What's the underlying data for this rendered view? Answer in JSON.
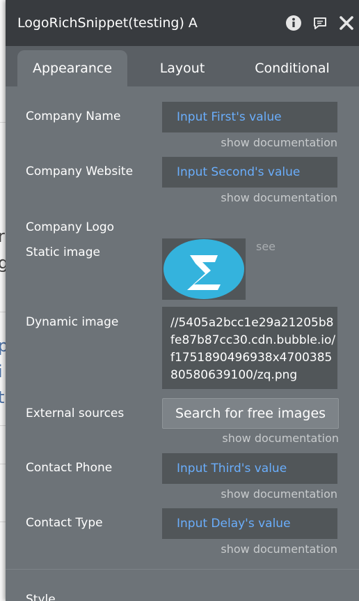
{
  "panel": {
    "title": "LogoRichSnippet(testing) A",
    "icons": [
      "info-icon",
      "comment-icon",
      "close-icon"
    ]
  },
  "tabs": [
    {
      "label": "Appearance",
      "active": true
    },
    {
      "label": "Layout",
      "active": false
    },
    {
      "label": "Conditional",
      "active": false
    }
  ],
  "fields": {
    "company_name": {
      "label": "Company Name",
      "value": "Input First's value",
      "doc": "show documentation"
    },
    "company_website": {
      "label": "Company Website",
      "value": "Input Second's value",
      "doc": "show documentation"
    },
    "company_logo": {
      "label": "Company Logo"
    },
    "static_image": {
      "label": "Static image",
      "see": "see"
    },
    "dynamic_image": {
      "label": "Dynamic image",
      "value": "//5405a2bcc1e29a21205b8fe87b87cc30.cdn.bubble.io/f1751890496938x470038580580639100/zq.png"
    },
    "external_sources": {
      "label": "External sources",
      "button": "Search for free images",
      "doc": "show documentation"
    },
    "contact_phone": {
      "label": "Contact Phone",
      "value": "Input Third's value",
      "doc": "show documentation"
    },
    "contact_type": {
      "label": "Contact Type",
      "value": "Input Delay's value",
      "doc": "show documentation"
    },
    "style": {
      "label": "Style"
    }
  },
  "colors": {
    "panel_bg": "#6d7378",
    "titlebar_bg": "#383b3f",
    "input_bg": "#515659",
    "dynamic_value": "#6aaefc",
    "logo_bg": "#34b3dd"
  }
}
